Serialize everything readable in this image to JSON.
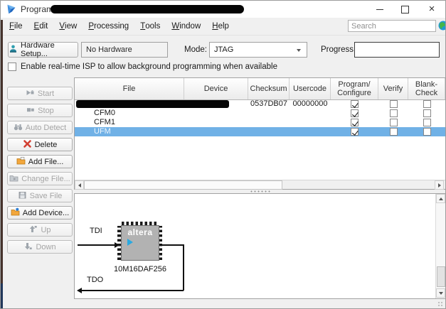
{
  "window": {
    "title": "Programmer - ",
    "close_glyph": "×"
  },
  "menu": {
    "items": [
      "File",
      "Edit",
      "View",
      "Processing",
      "Tools",
      "Window",
      "Help"
    ]
  },
  "search": {
    "placeholder": "Search"
  },
  "toolbar": {
    "hardware_setup": "Hardware Setup...",
    "hardware_status": "No Hardware",
    "mode_label": "Mode:",
    "mode_value": "JTAG",
    "progress_label": "Progress:",
    "progress_value": ""
  },
  "isp": {
    "label": "Enable real-time ISP to allow background programming when available",
    "checked": false
  },
  "actions": [
    {
      "label": "Start",
      "icon": "start-icon",
      "enabled": false
    },
    {
      "label": "Stop",
      "icon": "stop-icon",
      "enabled": false
    },
    {
      "label": "Auto Detect",
      "icon": "auto-detect-icon",
      "enabled": false
    },
    {
      "label": "Delete",
      "icon": "delete-icon",
      "enabled": true
    },
    {
      "label": "Add File...",
      "icon": "add-file-icon",
      "enabled": true
    },
    {
      "label": "Change File...",
      "icon": "change-file-icon",
      "enabled": false
    },
    {
      "label": "Save File",
      "icon": "save-file-icon",
      "enabled": false
    },
    {
      "label": "Add Device...",
      "icon": "add-device-icon",
      "enabled": true
    },
    {
      "label": "Up",
      "icon": "up-icon",
      "enabled": false
    },
    {
      "label": "Down",
      "icon": "down-icon",
      "enabled": false
    }
  ],
  "table": {
    "columns": [
      "File",
      "Device",
      "Checksum",
      "Usercode",
      "Program/\nConfigure",
      "Verify",
      "Blank-\nCheck"
    ],
    "rows": [
      {
        "file": "",
        "redacted": true,
        "device": "",
        "checksum": "0537DB07",
        "usercode": "00000000",
        "program_configure": true,
        "verify": false,
        "blank_check": false,
        "selected": false,
        "indent": false
      },
      {
        "file": "CFM0",
        "redacted": false,
        "device": "",
        "checksum": "",
        "usercode": "",
        "program_configure": true,
        "verify": false,
        "blank_check": false,
        "selected": false,
        "indent": true
      },
      {
        "file": "CFM1",
        "redacted": false,
        "device": "",
        "checksum": "",
        "usercode": "",
        "program_configure": true,
        "verify": false,
        "blank_check": false,
        "selected": false,
        "indent": true
      },
      {
        "file": "UFM",
        "redacted": false,
        "device": "",
        "checksum": "",
        "usercode": "",
        "program_configure": true,
        "verify": false,
        "blank_check": false,
        "selected": true,
        "indent": true
      }
    ]
  },
  "jtag_chain": {
    "tdi_label": "TDI",
    "tdo_label": "TDO",
    "device_name": "10M16DAF256",
    "vendor_logo": "altera"
  },
  "colors": {
    "selection_blue": "#70b1e6",
    "selection_text": "#eef5fc",
    "logo_triangle_blue": "#2aa9e0",
    "delete_red": "#d23f31",
    "folder_yellow": "#f3a73c",
    "teal_icon": "#2f9fb0"
  }
}
